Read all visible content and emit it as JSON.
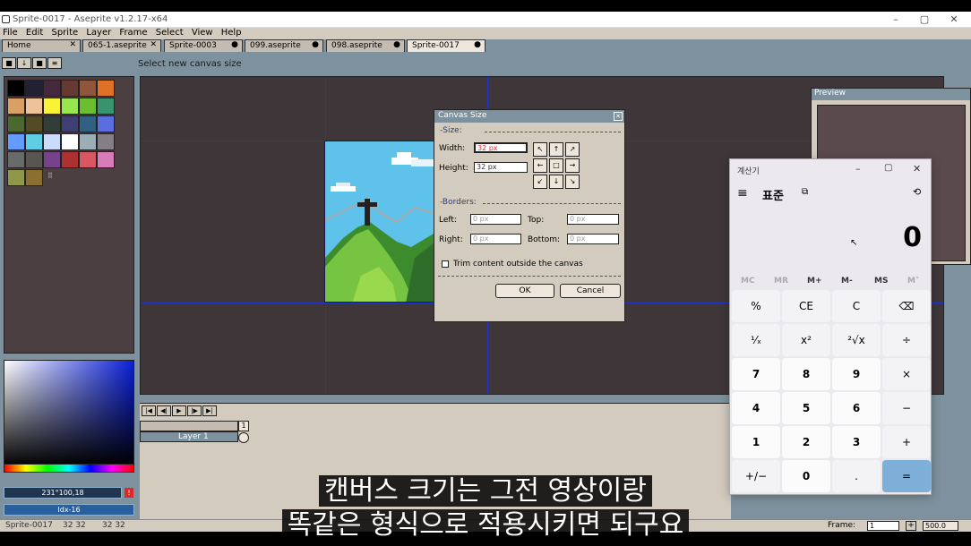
{
  "window": {
    "title": "Sprite-0017 - Aseprite v1.2.17-x64",
    "min": "–",
    "max": "▢",
    "close": "✕"
  },
  "menu": [
    "File",
    "Edit",
    "Sprite",
    "Layer",
    "Frame",
    "Select",
    "View",
    "Help"
  ],
  "tabs": [
    {
      "label": "Home",
      "mark": "✕"
    },
    {
      "label": "065-1.aseprite",
      "mark": "✕"
    },
    {
      "label": "Sprite-0003",
      "mark": "●"
    },
    {
      "label": "099.aseprite",
      "mark": "●"
    },
    {
      "label": "098.aseprite",
      "mark": "●"
    },
    {
      "label": "Sprite-0017",
      "mark": "●"
    }
  ],
  "hint": "Select new canvas size",
  "palette": {
    "colors": [
      "#000000",
      "#222034",
      "#45283c",
      "#663931",
      "#8f563b",
      "#df7126",
      "#d9a066",
      "#eec39a",
      "#fbf236",
      "#99e550",
      "#6abe30",
      "#37946e",
      "#4b692f",
      "#524b24",
      "#323c39",
      "#3f3f74",
      "#306082",
      "#5b6ee1",
      "#639bff",
      "#5fcde4",
      "#cbdbfc",
      "#ffffff",
      "#9badb7",
      "#847e87",
      "#696a6a",
      "#595652",
      "#76428a",
      "#ac3232",
      "#d95763",
      "#d77bba",
      "#8f974a",
      "#8a6f30"
    ],
    "more": "⠿"
  },
  "color": {
    "rgb": "231°100,18",
    "warn": "!",
    "index": "Idx-16"
  },
  "dialog": {
    "title": "Canvas Size",
    "size_section": "-Size:",
    "width_label": "Width:",
    "width_value": "32 px",
    "height_label": "Height:",
    "height_value": "32 px",
    "borders_section": "-Borders:",
    "left_label": "Left:",
    "left_value": "0 px",
    "top_label": "Top:",
    "top_value": "0 px",
    "right_label": "Right:",
    "right_value": "0 px",
    "bottom_label": "Bottom:",
    "bottom_value": "0 px",
    "trim_label": "Trim content outside the canvas",
    "ok": "OK",
    "cancel": "Cancel",
    "close": "✕"
  },
  "preview": {
    "title": "Preview"
  },
  "timeline": {
    "layer": "Layer 1",
    "frame_no": "1"
  },
  "status": {
    "sprite": "Sprite-0017",
    "size_a": "32 32",
    "size_b": "32 32",
    "frame_label": "Frame:",
    "frame_value": "1",
    "zoom": "500.0"
  },
  "calculator": {
    "title": "계산기",
    "mode": "표준",
    "display": "0",
    "memory": [
      "MC",
      "MR",
      "M+",
      "M-",
      "MS",
      "M˅"
    ],
    "keys": [
      [
        "%",
        "CE",
        "C",
        "⌫"
      ],
      [
        "¹⁄ₓ",
        "x²",
        "²√x",
        "÷"
      ],
      [
        "7",
        "8",
        "9",
        "×"
      ],
      [
        "4",
        "5",
        "6",
        "−"
      ],
      [
        "1",
        "2",
        "3",
        "+"
      ],
      [
        "+/−",
        "0",
        ".",
        "="
      ]
    ]
  },
  "subtitle": {
    "line1": "캔버스 크기는 그전 영상이랑",
    "line2": "똑같은 형식으로 적용시키면 되구요"
  }
}
